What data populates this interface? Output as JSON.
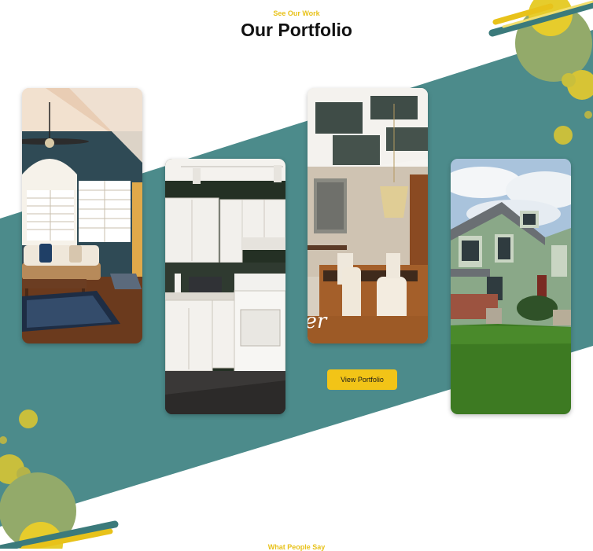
{
  "header": {
    "eyebrow": "See Our Work",
    "title": "Our Portfolio"
  },
  "portfolio": {
    "items": [
      {
        "name": "living-room"
      },
      {
        "name": "kitchen"
      },
      {
        "name": "dining-room"
      },
      {
        "name": "house-exterior"
      }
    ],
    "dining_caption": "ter",
    "button_label": "View Portfolio"
  },
  "next_section": {
    "eyebrow": "What People Say"
  },
  "colors": {
    "teal": "#4c8b8b",
    "accent_yellow": "#e8c21a",
    "button_yellow": "#f2c417",
    "olive": "#b5b348"
  }
}
